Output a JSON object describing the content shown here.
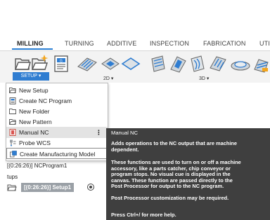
{
  "tabs": [
    {
      "label": "MILLING",
      "active": true
    },
    {
      "label": "TURNING",
      "active": false
    },
    {
      "label": "ADDITIVE",
      "active": false
    },
    {
      "label": "INSPECTION",
      "active": false
    },
    {
      "label": "FABRICATION",
      "active": false
    },
    {
      "label": "UTILI",
      "active": false
    }
  ],
  "toolbar": {
    "setup_label": "SETUP ▾",
    "group_2d_label": "2D ▾",
    "group_3d_label": "3D ▾"
  },
  "menu": {
    "items": [
      {
        "label": "New Setup",
        "icon": "new-setup-icon"
      },
      {
        "label": "Create NC Program",
        "icon": "nc-program-icon"
      },
      {
        "label": "New Folder",
        "icon": "folder-icon"
      },
      {
        "label": "New Pattern",
        "icon": "pattern-icon"
      },
      {
        "label": "Manual NC",
        "icon": "manual-nc-icon",
        "highlighted": true,
        "more": "⋮"
      },
      {
        "label": "Probe WCS",
        "icon": "probe-icon"
      },
      {
        "label": "Create Manufacturing Model",
        "icon": "manufacturing-model-icon",
        "boxed": true
      }
    ]
  },
  "browser": {
    "ncprogram_label": "[(0:26:26)] NCProgram1",
    "setups_label": "tups",
    "setup_label": "[(0:26:26)] Setup1"
  },
  "tooltip": {
    "title": "Manual NC",
    "p1_line1": "Adds operations to the NC output that are machine",
    "p1_line2": "dependent.",
    "p2_line1": "These functions are used to turn on or off a machine",
    "p2_line2": "accessory, like a parts catcher, chip conveyor or",
    "p2_line3": "program stops. No visual cue is displayed in the",
    "p2_line4": "canvas. These function are passed directly to the",
    "p2_line5": "Post Processor for output to the NC program.",
    "p3": "Post Processor customization may be required.",
    "p4": "Press Ctrl+/ for more help."
  },
  "colors": {
    "accent": "#2f7dd1",
    "tooltip_bg": "#3f3f3f",
    "menu_highlight": "#e3e3e3"
  }
}
